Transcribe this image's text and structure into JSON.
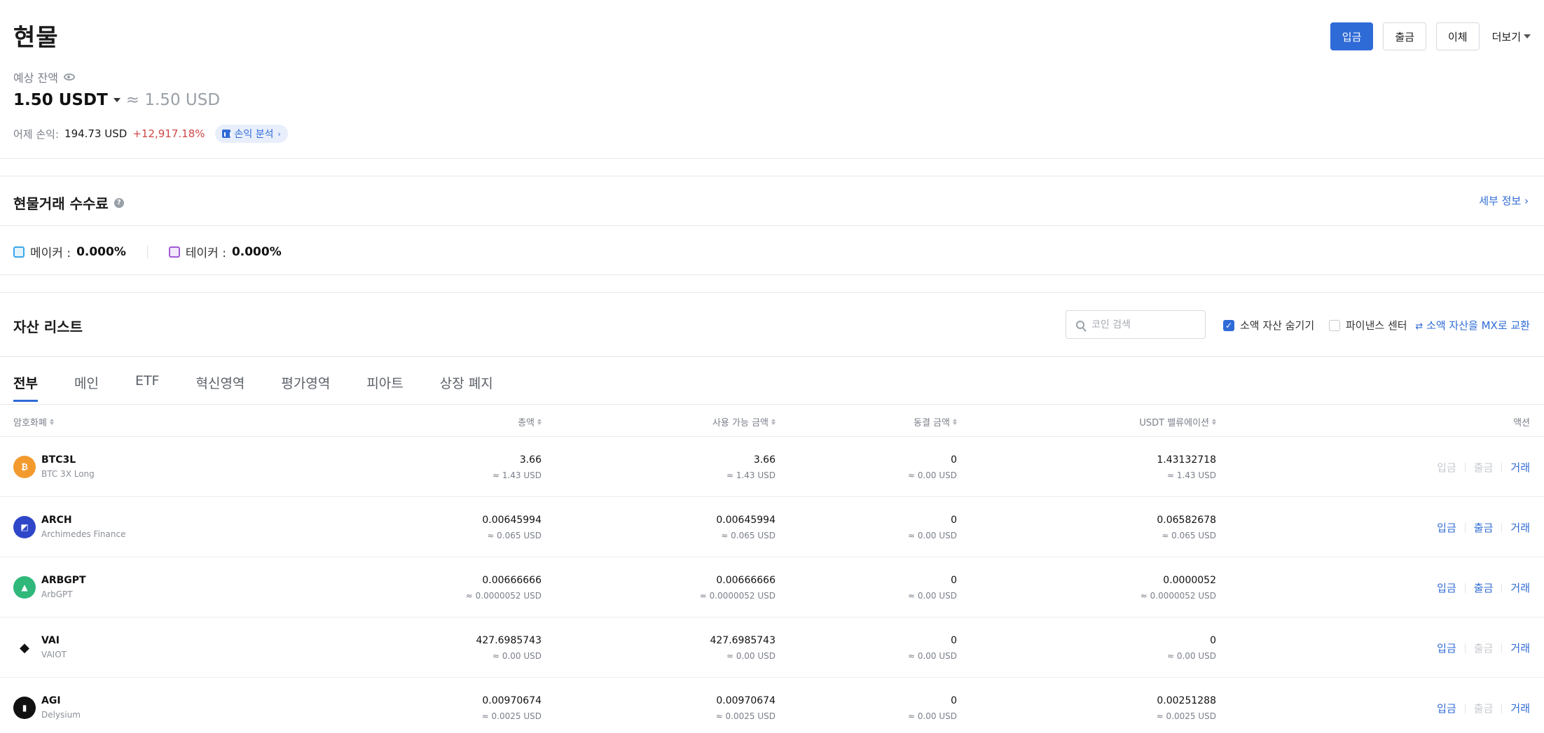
{
  "header": {
    "title": "현물",
    "buttons": {
      "deposit": "입금",
      "withdraw": "출금",
      "transfer": "이체",
      "more": "더보기"
    }
  },
  "balance": {
    "label": "예상 잔액",
    "amount": "1.50 USDT",
    "approx": "≈ 1.50 USD",
    "pnl_label": "어제 손익:",
    "pnl_usd": "194.73 USD",
    "pnl_pct": "+12,917.18%",
    "pnl_button": "손익 분석"
  },
  "fees": {
    "title": "현물거래 수수료",
    "detail_link": "세부 정보",
    "maker_label": "메이커 :",
    "maker_value": "0.000%",
    "taker_label": "테이커 :",
    "taker_value": "0.000%"
  },
  "assets": {
    "title": "자산 리스트",
    "search_placeholder": "코인 검색",
    "hide_small_label": "소액 자산 숨기기",
    "finance_center_label": "파이낸스 센터",
    "swap_link": "소액 자산을 MX로 교환",
    "tabs": [
      "전부",
      "메인",
      "ETF",
      "혁신영역",
      "평가영역",
      "피아트",
      "상장 폐지"
    ],
    "columns": {
      "coin": "암호화폐",
      "total": "총액",
      "available": "사용 가능 금액",
      "frozen": "동결 금액",
      "valuation": "USDT 밸류에이션",
      "action": "액션"
    },
    "action_labels": {
      "deposit": "입금",
      "withdraw": "출금",
      "trade": "거래"
    },
    "rows": [
      {
        "symbol": "BTC3L",
        "name": "BTC 3X Long",
        "icon": "btc3l-icon",
        "color": "#f39a2f",
        "total": "3.66",
        "total_usd": "≈ 1.43 USD",
        "available": "3.66",
        "available_usd": "≈ 1.43 USD",
        "frozen": "0",
        "frozen_usd": "≈ 0.00 USD",
        "valuation": "1.43132718",
        "valuation_usd": "≈ 1.43 USD",
        "deposit_enabled": false,
        "withdraw_enabled": false
      },
      {
        "symbol": "ARCH",
        "name": "Archimedes Finance",
        "icon": "arch-icon",
        "color": "#2f46c8",
        "total": "0.00645994",
        "total_usd": "≈ 0.065 USD",
        "available": "0.00645994",
        "available_usd": "≈ 0.065 USD",
        "frozen": "0",
        "frozen_usd": "≈ 0.00 USD",
        "valuation": "0.06582678",
        "valuation_usd": "≈ 0.065 USD",
        "deposit_enabled": true,
        "withdraw_enabled": true
      },
      {
        "symbol": "ARBGPT",
        "name": "ArbGPT",
        "icon": "arbgpt-icon",
        "color": "#2fb87a",
        "total": "0.00666666",
        "total_usd": "≈ 0.0000052 USD",
        "available": "0.00666666",
        "available_usd": "≈ 0.0000052 USD",
        "frozen": "0",
        "frozen_usd": "≈ 0.00 USD",
        "valuation": "0.0000052",
        "valuation_usd": "≈ 0.0000052 USD",
        "deposit_enabled": true,
        "withdraw_enabled": true
      },
      {
        "symbol": "VAI",
        "name": "VAIOT",
        "icon": "vai-icon",
        "color": "#111111",
        "total": "427.6985743",
        "total_usd": "≈ 0.00 USD",
        "available": "427.6985743",
        "available_usd": "≈ 0.00 USD",
        "frozen": "0",
        "frozen_usd": "≈ 0.00 USD",
        "valuation": "0",
        "valuation_usd": "≈ 0.00 USD",
        "deposit_enabled": true,
        "withdraw_enabled": false
      },
      {
        "symbol": "AGI",
        "name": "Delysium",
        "icon": "agi-icon",
        "color": "#111111",
        "total": "0.00970674",
        "total_usd": "≈ 0.0025 USD",
        "available": "0.00970674",
        "available_usd": "≈ 0.0025 USD",
        "frozen": "0",
        "frozen_usd": "≈ 0.00 USD",
        "valuation": "0.00251288",
        "valuation_usd": "≈ 0.0025 USD",
        "deposit_enabled": true,
        "withdraw_enabled": false
      }
    ]
  }
}
